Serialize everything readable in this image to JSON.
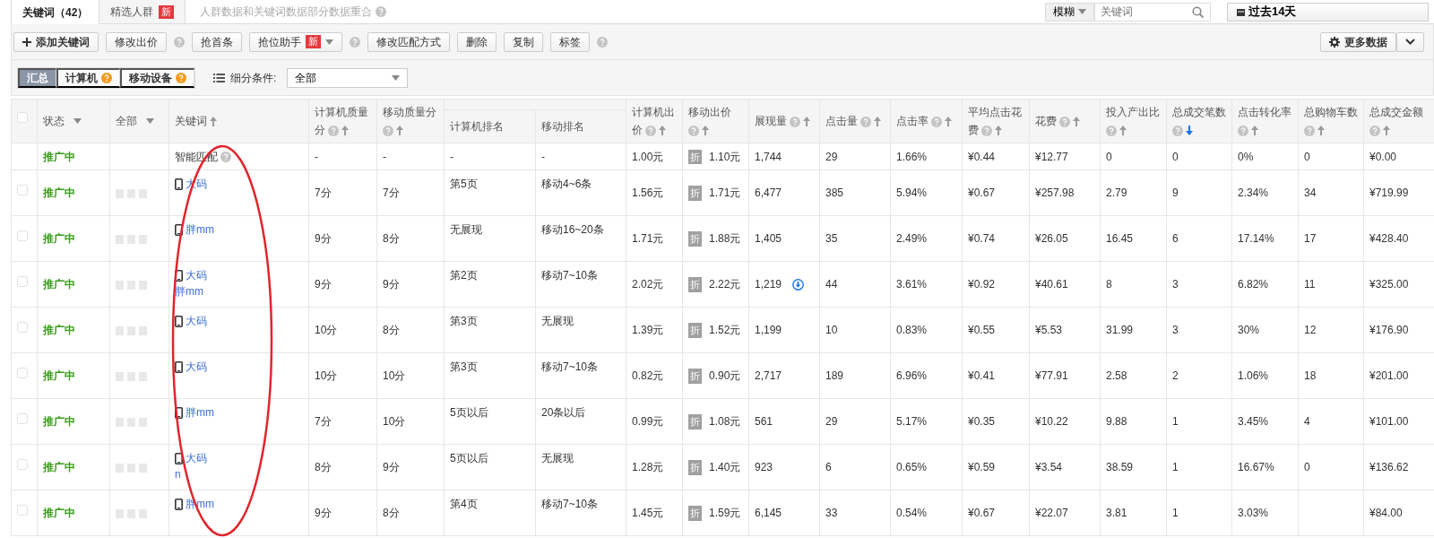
{
  "tabs": [
    {
      "label": "关键词（42）",
      "selected": true
    },
    {
      "label": "精选人群",
      "badge": "新",
      "selected": false
    }
  ],
  "notice": "人群数据和关键词数据部分数据重合",
  "match_select": "模糊",
  "search": {
    "placeholder": "关键词"
  },
  "date_button": "过去14天",
  "toolbar": [
    {
      "label": "添加关键词",
      "kind": "add",
      "help": false
    },
    {
      "label": "修改出价",
      "kind": "plain",
      "help": true
    },
    {
      "label": "抢首条",
      "kind": "plain",
      "help": false
    },
    {
      "label": "抢位助手",
      "kind": "dropdown",
      "badge": "新",
      "help": true
    },
    {
      "label": "修改匹配方式",
      "kind": "plain",
      "help": false
    },
    {
      "label": "删除",
      "kind": "plain",
      "help": false
    },
    {
      "label": "复制",
      "kind": "plain",
      "help": false
    },
    {
      "label": "标签",
      "kind": "plain",
      "help": true
    }
  ],
  "more_data": "更多数据",
  "segments": [
    {
      "label": "汇总",
      "selected": true,
      "warn": false
    },
    {
      "label": "计算机",
      "selected": false,
      "warn": true
    },
    {
      "label": "移动设备",
      "selected": false,
      "warn": true
    }
  ],
  "filter": {
    "label": "细分条件:",
    "value": "全部"
  },
  "select_all": {
    "checked": false
  },
  "columns": [
    {
      "label": "状态",
      "kind": "dropdown"
    },
    {
      "label": "全部",
      "kind": "dropdown"
    },
    {
      "label": "关键词",
      "kind": "keyword",
      "sort_active": false,
      "help": false
    },
    {
      "label": "计算机质量分",
      "kind": "metric",
      "help": true,
      "sort_active": false
    },
    {
      "label": "移动质量分",
      "kind": "metric",
      "help": true,
      "sort_active": false
    },
    {
      "label": "计算机排名",
      "kind": "rank"
    },
    {
      "label": "移动排名",
      "kind": "rank"
    },
    {
      "label": "计算机出价",
      "kind": "metric",
      "help": true,
      "sort_active": false
    },
    {
      "label": "移动出价",
      "kind": "bid",
      "help": true,
      "sort_active": false
    },
    {
      "label": "展现量",
      "kind": "impressions",
      "help": true,
      "sort_active": false
    },
    {
      "label": "点击量",
      "kind": "metric",
      "help": true,
      "sort_active": false
    },
    {
      "label": "点击率",
      "kind": "metric",
      "help": true,
      "sort_active": false
    },
    {
      "label": "平均点击花费",
      "kind": "metric",
      "help": true,
      "sort_active": false
    },
    {
      "label": "花费",
      "kind": "metric",
      "help": true,
      "sort_active": false
    },
    {
      "label": "投入产出比",
      "kind": "metric",
      "help": true,
      "sort_active": false
    },
    {
      "label": "总成交笔数",
      "kind": "metric",
      "help": true,
      "sort_active": true
    },
    {
      "label": "点击转化率",
      "kind": "metric",
      "help": true,
      "sort_active": false
    },
    {
      "label": "总购物车数",
      "kind": "metric",
      "help": true,
      "sort_active": false
    },
    {
      "label": "总成交金额",
      "kind": "metric",
      "help": true,
      "sort_active": false
    }
  ],
  "rows": [
    {
      "kind": "smart",
      "status": "推广中",
      "keyword": [
        "智能匹配"
      ],
      "help": true,
      "bid_tag": "折",
      "alert": false,
      "cells": [
        "-",
        "-",
        "-",
        "-",
        "1.00元",
        "1.10元",
        "1,744",
        "29",
        "1.66%",
        "¥0.44",
        "¥12.77",
        "0",
        "0",
        "0%",
        "0",
        "¥0.00"
      ]
    },
    {
      "kind": "keyword",
      "checked": false,
      "status": "推广中",
      "keyword": [
        "大码"
      ],
      "bid_tag": "折",
      "alert": false,
      "cells": [
        "7分",
        "7分",
        "第5页",
        "移动4~6条",
        "1.56元",
        "1.71元",
        "6,477",
        "385",
        "5.94%",
        "¥0.67",
        "¥257.98",
        "2.79",
        "9",
        "2.34%",
        "34",
        "¥719.99"
      ]
    },
    {
      "kind": "keyword",
      "checked": false,
      "status": "推广中",
      "keyword": [
        "胖mm"
      ],
      "bid_tag": "折",
      "alert": false,
      "cells": [
        "9分",
        "8分",
        "无展现",
        "移动16~20条",
        "1.71元",
        "1.88元",
        "1,405",
        "35",
        "2.49%",
        "¥0.74",
        "¥26.05",
        "16.45",
        "6",
        "17.14%",
        "17",
        "¥428.40"
      ]
    },
    {
      "kind": "keyword",
      "checked": false,
      "status": "推广中",
      "keyword": [
        "大码",
        "胖mm"
      ],
      "bid_tag": "折",
      "alert": true,
      "cells": [
        "9分",
        "9分",
        "第2页",
        "移动7~10条",
        "2.02元",
        "2.22元",
        "1,219",
        "44",
        "3.61%",
        "¥0.92",
        "¥40.61",
        "8",
        "3",
        "6.82%",
        "11",
        "¥325.00"
      ]
    },
    {
      "kind": "keyword",
      "checked": false,
      "status": "推广中",
      "keyword": [
        "大码"
      ],
      "bid_tag": "折",
      "alert": false,
      "cells": [
        "10分",
        "8分",
        "第3页",
        "无展现",
        "1.39元",
        "1.52元",
        "1,199",
        "10",
        "0.83%",
        "¥0.55",
        "¥5.53",
        "31.99",
        "3",
        "30%",
        "12",
        "¥176.90"
      ]
    },
    {
      "kind": "keyword",
      "checked": false,
      "status": "推广中",
      "keyword": [
        "大码"
      ],
      "bid_tag": "折",
      "alert": false,
      "cells": [
        "10分",
        "10分",
        "第3页",
        "移动7~10条",
        "0.82元",
        "0.90元",
        "2,717",
        "189",
        "6.96%",
        "¥0.41",
        "¥77.91",
        "2.58",
        "2",
        "1.06%",
        "18",
        "¥201.00"
      ]
    },
    {
      "kind": "keyword",
      "checked": false,
      "status": "推广中",
      "keyword": [
        "胖mm"
      ],
      "bid_tag": "折",
      "alert": false,
      "cells": [
        "7分",
        "10分",
        "5页以后",
        "20条以后",
        "0.99元",
        "1.08元",
        "561",
        "29",
        "5.17%",
        "¥0.35",
        "¥10.22",
        "9.88",
        "1",
        "3.45%",
        "4",
        "¥101.00"
      ]
    },
    {
      "kind": "keyword",
      "checked": false,
      "status": "推广中",
      "keyword": [
        "大码",
        "n"
      ],
      "bid_tag": "折",
      "alert": false,
      "cells": [
        "8分",
        "9分",
        "5页以后",
        "无展现",
        "1.28元",
        "1.40元",
        "923",
        "6",
        "0.65%",
        "¥0.59",
        "¥3.54",
        "38.59",
        "1",
        "16.67%",
        "0",
        "¥136.62"
      ]
    },
    {
      "kind": "keyword",
      "checked": false,
      "status": "推广中",
      "keyword": [
        "胖mm"
      ],
      "bid_tag": "折",
      "alert": false,
      "cells": [
        "9分",
        "8分",
        "第4页",
        "移动7~10条",
        "1.45元",
        "1.59元",
        "6,145",
        "33",
        "0.54%",
        "¥0.67",
        "¥22.07",
        "3.81",
        "1",
        "3.03%",
        null,
        "¥84.00"
      ]
    }
  ]
}
